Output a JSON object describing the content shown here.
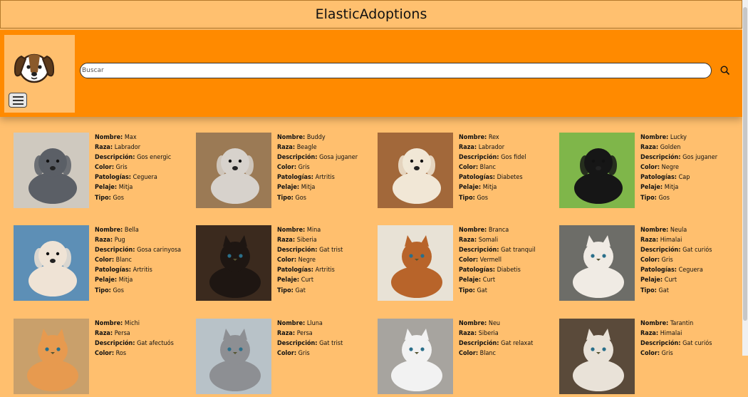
{
  "app": {
    "title": "ElasticAdoptions"
  },
  "search": {
    "placeholder": "Buscar"
  },
  "labels": {
    "name": "Nombre:",
    "breed": "Raza:",
    "description": "Descripción:",
    "color": "Color:",
    "pathology": "Patologías:",
    "coat": "Pelaje:",
    "type": "Tipo:"
  },
  "pets": [
    {
      "name": "Max",
      "breed": "Labrador",
      "description": "Gos energic",
      "color": "Gris",
      "pathology": "Ceguera",
      "coat": "Mitja",
      "type": "Gos"
    },
    {
      "name": "Buddy",
      "breed": "Beagle",
      "description": "Gosa juganer",
      "color": "Gris",
      "pathology": "Artritis",
      "coat": "Mitja",
      "type": "Gos"
    },
    {
      "name": "Rex",
      "breed": "Labrador",
      "description": "Gos fidel",
      "color": "Blanc",
      "pathology": "Diabetes",
      "coat": "Mitja",
      "type": "Gos"
    },
    {
      "name": "Lucky",
      "breed": "Golden",
      "description": "Gos juganer",
      "color": "Negre",
      "pathology": "Cap",
      "coat": "Mitja",
      "type": "Gos"
    },
    {
      "name": "Bella",
      "breed": "Pug",
      "description": "Gosa carinyosa",
      "color": "Blanc",
      "pathology": "Artritis",
      "coat": "Mitja",
      "type": "Gos"
    },
    {
      "name": "Mina",
      "breed": "Siberia",
      "description": "Gat trist",
      "color": "Negre",
      "pathology": "Artritis",
      "coat": "Curt",
      "type": "Gat"
    },
    {
      "name": "Branca",
      "breed": "Somali",
      "description": "Gat tranquil",
      "color": "Vermell",
      "pathology": "Diabetis",
      "coat": "Curt",
      "type": "Gat"
    },
    {
      "name": "Neula",
      "breed": "Himalai",
      "description": "Gat curiós",
      "color": "Gris",
      "pathology": "Ceguera",
      "coat": "Curt",
      "type": "Gat"
    },
    {
      "name": "Michi",
      "breed": "Persa",
      "description": "Gat afectuós",
      "color": "Ros",
      "pathology": "",
      "coat": "",
      "type": ""
    },
    {
      "name": "Lluna",
      "breed": "Persa",
      "description": "Gat trist",
      "color": "Gris",
      "pathology": "",
      "coat": "",
      "type": ""
    },
    {
      "name": "Neu",
      "breed": "Siberia",
      "description": "Gat relaxat",
      "color": "Blanc",
      "pathology": "",
      "coat": "",
      "type": ""
    },
    {
      "name": "Tarantin",
      "breed": "Himalai",
      "description": "Gat curiós",
      "color": "Gris",
      "pathology": "",
      "coat": "",
      "type": ""
    }
  ]
}
